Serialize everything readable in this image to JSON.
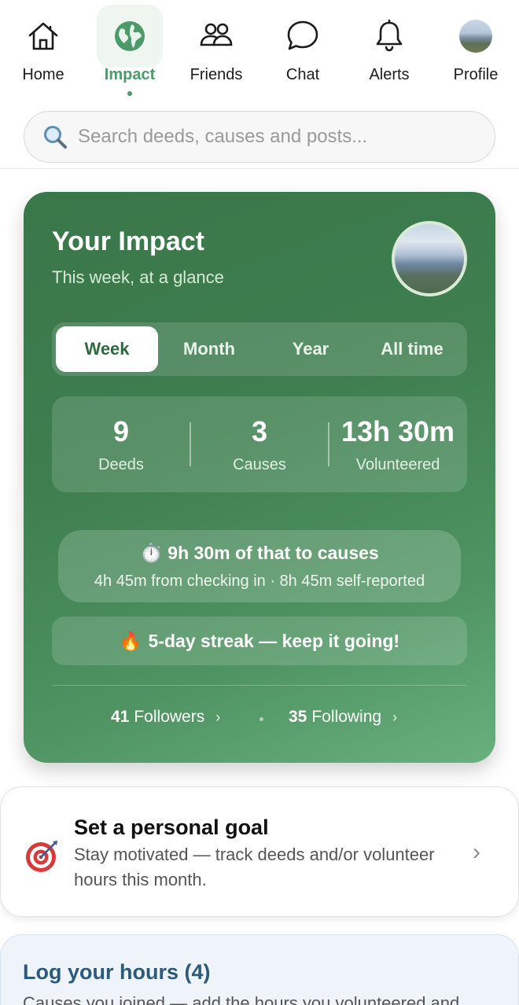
{
  "nav": {
    "items": [
      {
        "label": "Home",
        "icon": "home-icon"
      },
      {
        "label": "Impact",
        "icon": "globe-icon",
        "active": true
      },
      {
        "label": "Friends",
        "icon": "friends-icon"
      },
      {
        "label": "Chat",
        "icon": "chat-bubble-icon"
      },
      {
        "label": "Alerts",
        "icon": "bell-icon"
      },
      {
        "label": "Profile",
        "icon": "profile-avatar"
      }
    ],
    "accent": "#4c9a6a"
  },
  "search": {
    "placeholder": "Search deeds, causes and posts..."
  },
  "impact": {
    "title": "Your Impact",
    "subtitle": "This week, at a glance",
    "tabs": [
      {
        "label": "Week",
        "active": true
      },
      {
        "label": "Month"
      },
      {
        "label": "Year"
      },
      {
        "label": "All time"
      }
    ],
    "stats": [
      {
        "value": "9",
        "label": "Deeds"
      },
      {
        "value": "3",
        "label": "Causes"
      },
      {
        "value": "13h 30m",
        "label": "Volunteered"
      }
    ],
    "causes_time": {
      "headline": "9h 30m of that to causes",
      "detail": "4h 45m from checking in · 8h 45m self-reported"
    },
    "streak": "5-day streak — keep it going!",
    "followers": {
      "count": "41",
      "label": "Followers"
    },
    "following": {
      "count": "35",
      "label": "Following"
    },
    "colors": {
      "card_start": "#3a774a",
      "card_end": "#69b07e"
    }
  },
  "goal": {
    "title": "Set a personal goal",
    "description": "Stay motivated — track deeds and/or volunteer hours this month."
  },
  "log_hours": {
    "title": "Log your hours (4)",
    "description": "Causes you joined — add the hours you volunteered and"
  }
}
